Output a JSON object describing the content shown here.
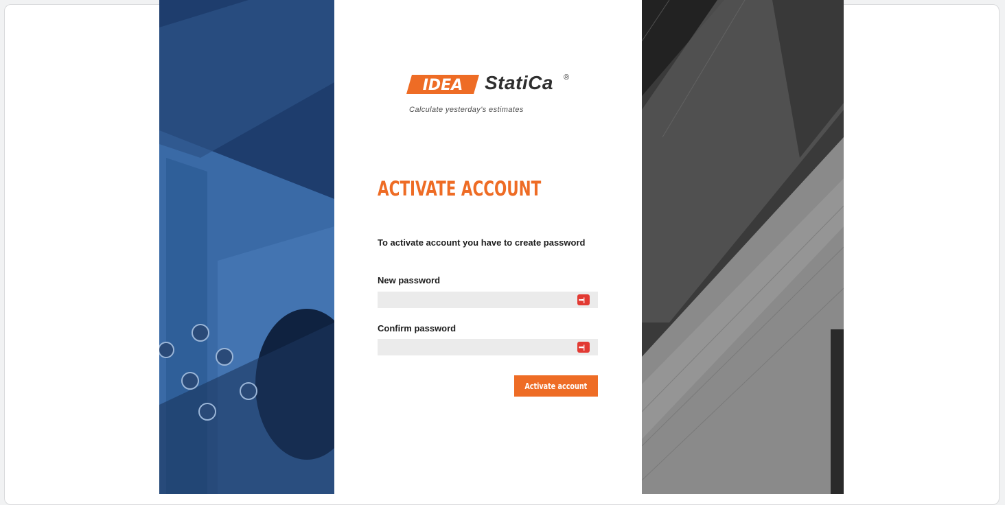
{
  "brand": {
    "logo_mark": "IDEA",
    "logo_word": "StatiCa",
    "logo_reg": "®",
    "tagline": "Calculate yesterday's estimates",
    "accent_color": "#ee6c25",
    "text_color": "#1d1d1d"
  },
  "form": {
    "title": "ACTIVATE ACCOUNT",
    "intro": "To activate account you have to create password",
    "new_password_label": "New password",
    "new_password_value": "",
    "confirm_password_label": "Confirm password",
    "confirm_password_value": "",
    "password_icon": "password-manager-icon",
    "submit_label": "Activate account"
  },
  "images": {
    "left": "structural-steel-connection-photo",
    "right": "concrete-structure-photo"
  }
}
